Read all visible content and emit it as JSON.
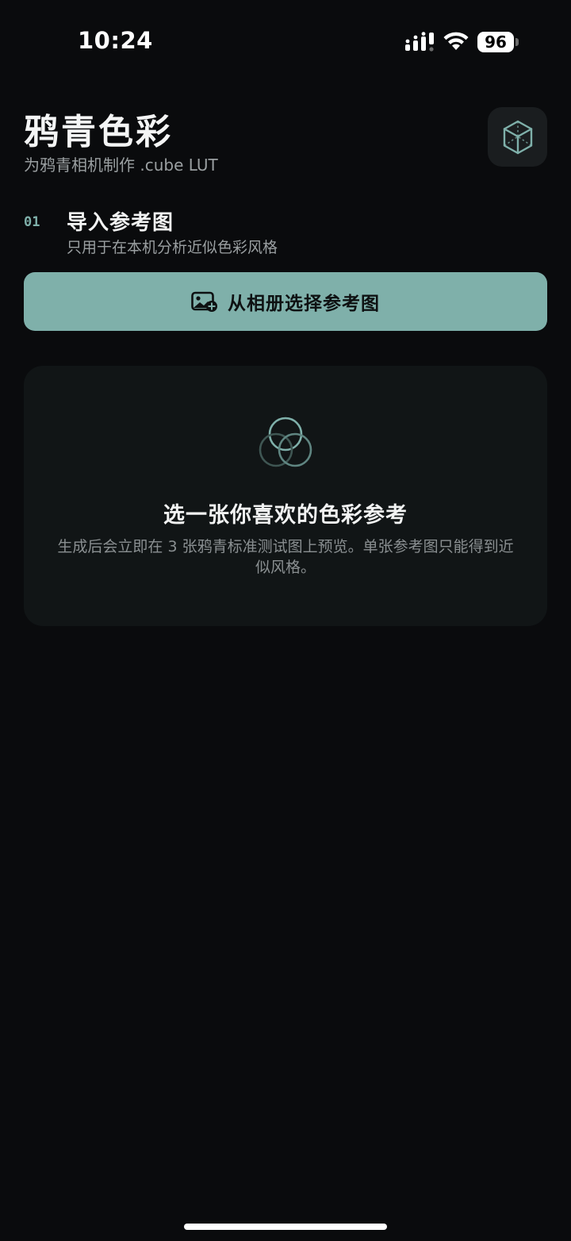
{
  "status_bar": {
    "time": "10:24",
    "battery": "96",
    "icons": [
      "signal-icon",
      "wifi-icon",
      "battery-icon"
    ]
  },
  "header": {
    "title": "鸦青色彩",
    "subtitle": "为鸦青相机制作 .cube LUT",
    "action_icon": "cube-icon"
  },
  "step": {
    "number": "01",
    "title": "导入参考图",
    "description": "只用于在本机分析近似色彩风格"
  },
  "primary_button": {
    "label": "从相册选择参考图",
    "icon": "add-photo-icon"
  },
  "empty_state": {
    "icon": "color-circles-icon",
    "title": "选一张你喜欢的色彩参考",
    "description": "生成后会立即在 3 张鸦青标准测试图上预览。单张参考图只能得到近似风格。"
  },
  "colors": {
    "background": "#0a0b0d",
    "accent": "#7fb0aa",
    "card": "#111516",
    "muted_text": "#9a9fa1"
  }
}
